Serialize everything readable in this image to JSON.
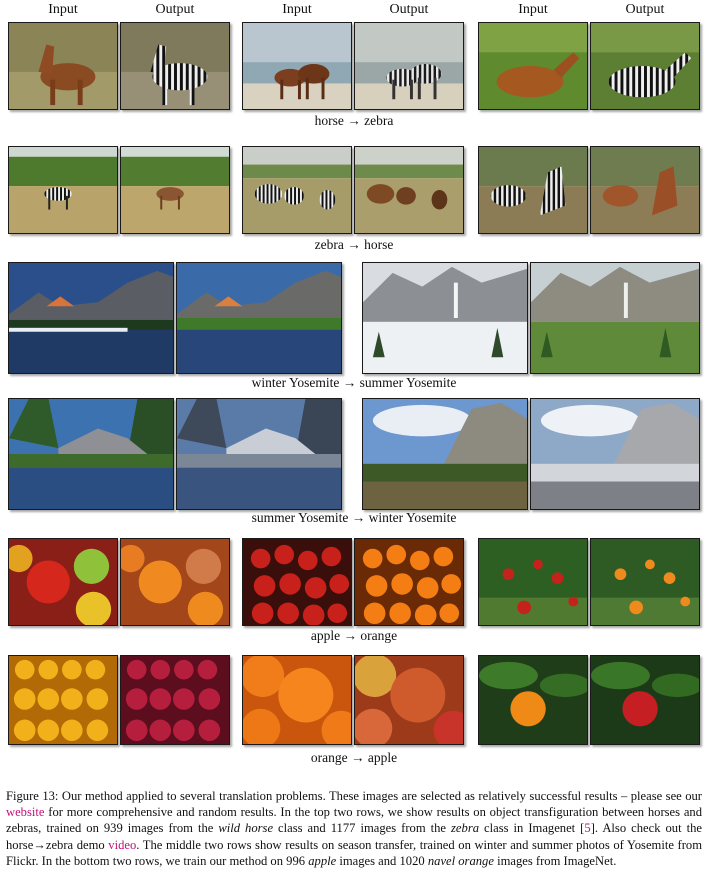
{
  "headers": [
    "Input",
    "Output",
    "Input",
    "Output",
    "Input",
    "Output"
  ],
  "row_labels": [
    "horse → zebra",
    "zebra → horse",
    "winter Yosemite → summer Yosemite",
    "summer Yosemite → winter Yosemite",
    "apple → orange",
    "orange → apple"
  ],
  "caption": {
    "p1": "Figure 13: Our method applied to several translation problems. These images are selected as relatively successful results – please see our ",
    "link1": "website",
    "p2": " for more comprehensive and random results. In the top two rows, we show results on object transfiguration between horses and zebras, trained on 939 images from the ",
    "em1": "wild horse",
    "p3": " class and 1177 images from the ",
    "em2": "zebra",
    "p4": " class in Imagenet [",
    "ref": "5",
    "p5": "]. Also check out the horse→zebra demo ",
    "link2": "video",
    "p6": ". The middle two rows show results on season transfer, trained on winter and summer photos of Yosemite from Flickr. In the bottom two rows, we train our method on 996 ",
    "em3": "apple",
    "p7": " images and 1020 ",
    "em4": "navel orange",
    "p8": " images from ImageNet."
  }
}
